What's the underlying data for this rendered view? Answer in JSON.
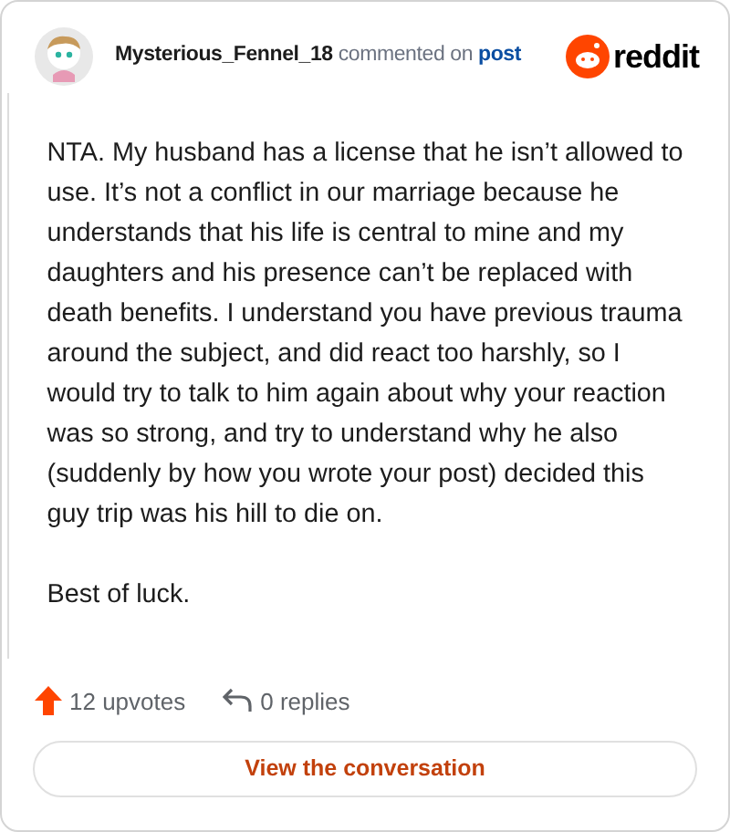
{
  "header": {
    "username": "Mysterious_Fennel_18",
    "action": "commented on",
    "link": "post",
    "brand": "reddit"
  },
  "comment": {
    "paragraphs": [
      "NTA. My husband has a license that he isn’t allowed to use. It’s not a conflict in our marriage because he understands that his life is central to mine and my daughters and his presence can’t be replaced with death benefits. I understand you have previous trauma around the subject, and did react too harshly, so I would try to talk to him again about why your reaction was so strong, and try to understand why he also (suddenly by how you wrote your post) decided this guy trip was his hill to die on.",
      "Best of luck."
    ]
  },
  "footer": {
    "upvotes": "12 upvotes",
    "replies": "0 replies",
    "button": "View the conversation"
  }
}
